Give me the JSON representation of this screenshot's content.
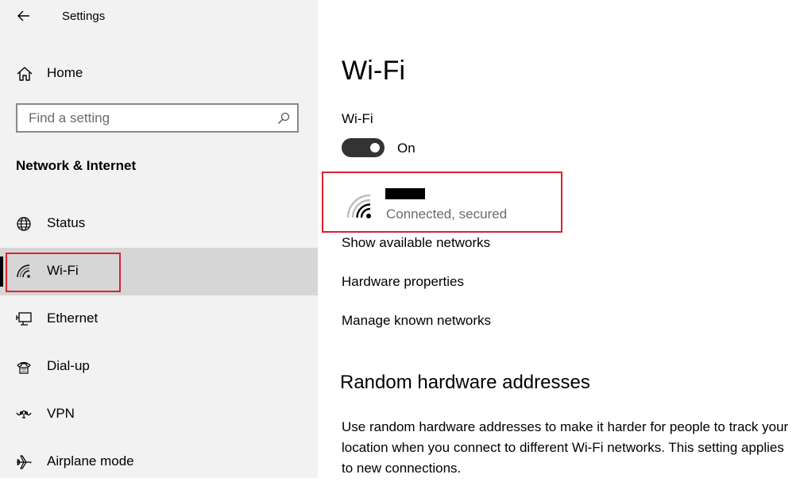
{
  "window": {
    "title": "Settings"
  },
  "sidebar": {
    "home_label": "Home",
    "search_placeholder": "Find a setting",
    "section_title": "Network & Internet",
    "items": [
      {
        "label": "Status",
        "icon": "globe-icon"
      },
      {
        "label": "Wi-Fi",
        "icon": "wifi-icon",
        "selected": true
      },
      {
        "label": "Ethernet",
        "icon": "ethernet-icon"
      },
      {
        "label": "Dial-up",
        "icon": "dialup-icon"
      },
      {
        "label": "VPN",
        "icon": "vpn-icon"
      },
      {
        "label": "Airplane mode",
        "icon": "airplane-icon"
      }
    ]
  },
  "main": {
    "title": "Wi-Fi",
    "wifi_label": "Wi-Fi",
    "toggle_state": "On",
    "network": {
      "status": "Connected, secured"
    },
    "links": {
      "show_networks": "Show available networks",
      "hardware_properties": "Hardware properties",
      "manage_networks": "Manage known networks"
    },
    "random_hw": {
      "heading": "Random hardware addresses",
      "description": "Use random hardware addresses to make it harder for people to track your location when you connect to different Wi-Fi networks. This setting applies to new connections."
    }
  },
  "colors": {
    "sidebar_bg": "#f2f2f2",
    "selected_bg": "#d6d6d6",
    "highlight_red": "#e0202c",
    "toggle_on": "#333333",
    "secondary_text": "#6b6b6b"
  }
}
